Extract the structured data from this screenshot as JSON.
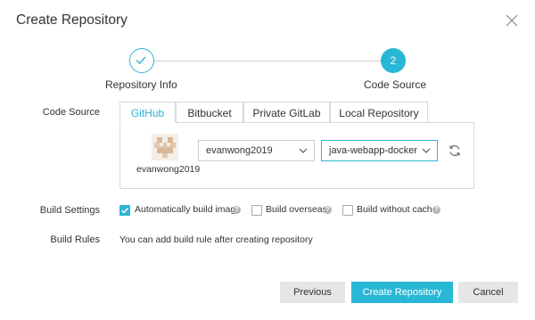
{
  "dialog": {
    "title": "Create Repository"
  },
  "steps": [
    {
      "label": "Repository Info",
      "state": "done"
    },
    {
      "label": "Code Source",
      "number": "2",
      "state": "active"
    }
  ],
  "code_source": {
    "label": "Code Source",
    "tabs": [
      "GitHub",
      "Bitbucket",
      "Private GitLab",
      "Local Repository"
    ],
    "active_tab": "GitHub",
    "account": {
      "username": "evanwong2019",
      "selected_org": "evanwong2019",
      "selected_repo": "java-webapp-docker"
    }
  },
  "build_settings": {
    "label": "Build Settings",
    "options": [
      {
        "label": "Automatically build image",
        "checked": true
      },
      {
        "label": "Build overseas",
        "checked": false
      },
      {
        "label": "Build without cache",
        "checked": false
      }
    ]
  },
  "build_rules": {
    "label": "Build Rules",
    "text": "You can add build rule after creating repository"
  },
  "footer": {
    "previous_label": "Previous",
    "create_label": "Create Repository",
    "cancel_label": "Cancel"
  },
  "colors": {
    "accent": "#29b7d6",
    "muted_button": "#e6e6e6"
  }
}
